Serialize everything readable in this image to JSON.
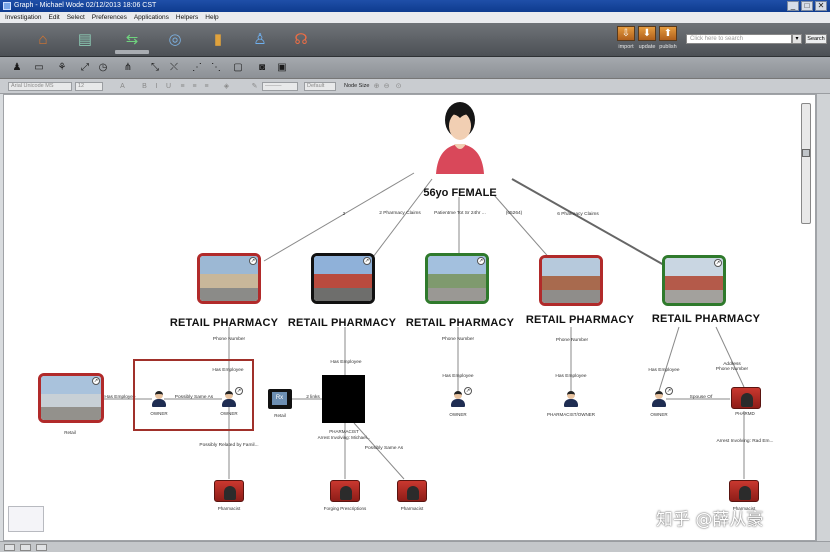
{
  "window": {
    "title": "Graph - Michael Wode 02/12/2013 18:06 CST",
    "controls": [
      "_",
      "□",
      "✕"
    ]
  },
  "menubar": {
    "items": [
      "Investigation",
      "Edit",
      "Select",
      "Preferences",
      "Applications",
      "Helpers",
      "Help"
    ]
  },
  "toolbar_main": {
    "icons": [
      "home-icon",
      "document-icon",
      "graph-icon",
      "globe-icon",
      "bar-chart-icon",
      "people-icon",
      "help-icon"
    ],
    "import_label": "import",
    "update_label": "update",
    "publish_label": "publish",
    "search_placeholder": "Click here to search",
    "search_button": "Search"
  },
  "toolbar_format": {
    "font_family": "Arial Unicode MS",
    "font_size": "12",
    "line_style": "Default",
    "node_size_label": "Node Size"
  },
  "graph": {
    "root": {
      "label": "56yo FEMALE"
    },
    "root_edges": [
      "2",
      "2 Pharmacy Claims",
      "Patientme Tot Sr 24hr ...",
      "(65264)",
      "6 Pharmacy Claims"
    ],
    "pharmacies": [
      {
        "title": "RETAIL PHARMACY",
        "edge_label": "Phone Number"
      },
      {
        "title": "RETAIL PHARMACY",
        "edge_label": "Has Employee"
      },
      {
        "title": "RETAIL PHARMACY",
        "edge_label": "Phone Number"
      },
      {
        "title": "RETAIL PHARMACY",
        "edge_label": "Phone Number"
      },
      {
        "title": "RETAIL PHARMACY",
        "edge_label": "Address\nPhone Number"
      }
    ],
    "labels": {
      "has_employee_left": "Has Employee",
      "has_employee_mid": "Has Employee",
      "possibly_same_as": "Possibly Same As",
      "owner_1": "OWNER",
      "owner_2": "OWNER",
      "retail": "Retail",
      "retail_2": "Retail",
      "links": "2 links",
      "possibly_related": "Possibly Related by Famil...",
      "pharmacist": "PHARMACIST",
      "arrest_1": "Arrest Involving: Michael...",
      "possibly_same_as_2": "Possibly Same As",
      "has_employee_3": "Has Employee",
      "owner_3": "OWNER",
      "has_employee_4": "Has Employee",
      "pharmacist_owner": "PHARMACIST/OWNER",
      "has_employee_5": "Has Employee",
      "spouse_of": "Spouse Of",
      "owner_5": "OWNER",
      "pharmd": "PHARMD",
      "arrest_2": "Arrest Involving: Rad Em...",
      "pharmacist_1": "Pharmacist",
      "forging": "Forging Prescriptions",
      "pharmacist_2": "Pharmacist",
      "pharmacist_3": "Pharmacist"
    }
  },
  "watermark": "知乎 @薛从豪"
}
